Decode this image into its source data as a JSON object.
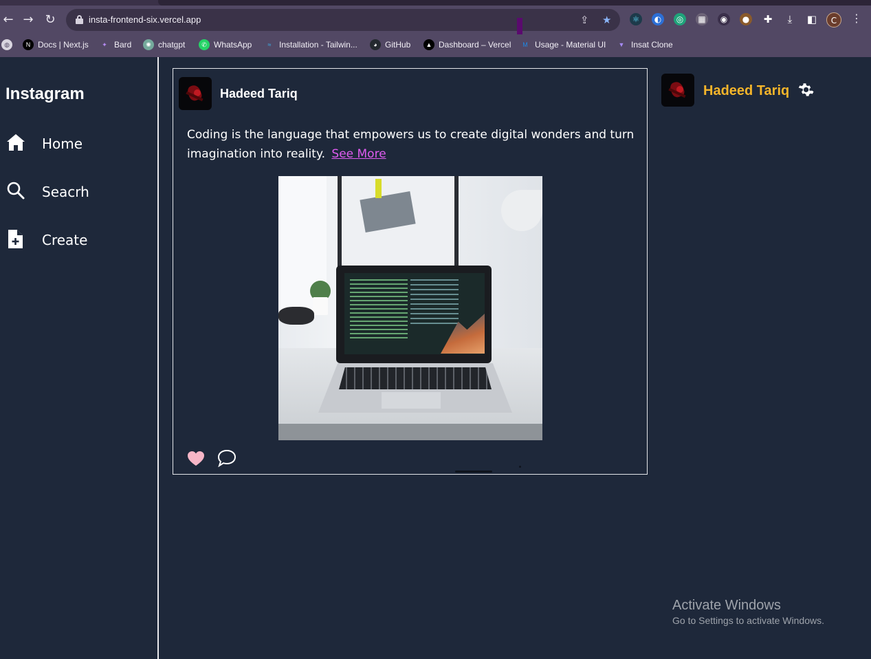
{
  "browser": {
    "url": "insta-frontend-six.vercel.app",
    "profile_initial": "C",
    "bookmarks": [
      {
        "label": "Docs | Next.js",
        "icon": "nextjs-icon"
      },
      {
        "label": "Bard",
        "icon": "bard-icon"
      },
      {
        "label": "chatgpt",
        "icon": "chatgpt-icon"
      },
      {
        "label": "WhatsApp",
        "icon": "whatsapp-icon"
      },
      {
        "label": "Installation - Tailwin...",
        "icon": "tailwind-icon"
      },
      {
        "label": "GitHub",
        "icon": "github-icon"
      },
      {
        "label": "Dashboard – Vercel",
        "icon": "vercel-icon"
      },
      {
        "label": "Usage - Material UI",
        "icon": "mui-icon"
      },
      {
        "label": "Insat Clone",
        "icon": "vite-icon"
      }
    ]
  },
  "sidebar": {
    "brand": "Instagram",
    "items": [
      {
        "label": "Home",
        "icon": "home-icon"
      },
      {
        "label": "Seacrh",
        "icon": "search-icon"
      },
      {
        "label": "Create",
        "icon": "create-file-icon"
      }
    ]
  },
  "post": {
    "username": "Hadeed Tariq",
    "caption": "Coding is the language that empowers us to create digital wonders and turn imagination into reality.",
    "see_more": "See More",
    "image": "laptop-with-code-photo"
  },
  "profile_panel": {
    "username": "Hadeed Tariq"
  },
  "overlay": {
    "activate_title": "Activate Windows",
    "activate_subtitle": "Go to Settings to activate Windows."
  },
  "colors": {
    "background": "#1e283a",
    "accent_username": "#f5b52a",
    "link": "#e05bf0",
    "heart": "#f7b6c7"
  }
}
